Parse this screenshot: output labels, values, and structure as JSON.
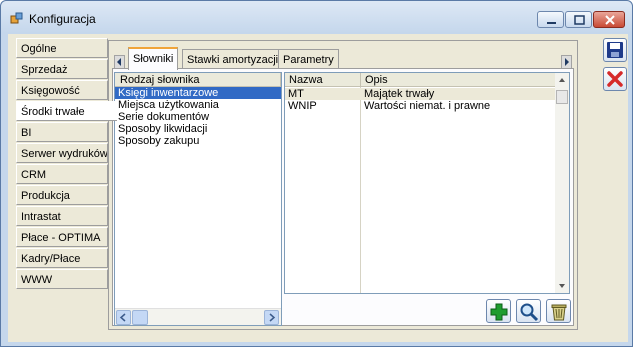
{
  "window": {
    "title": "Konfiguracja"
  },
  "nav": {
    "items": [
      {
        "label": "Ogólne"
      },
      {
        "label": "Sprzedaż"
      },
      {
        "label": "Księgowość"
      },
      {
        "label": "Środki trwałe"
      },
      {
        "label": "BI"
      },
      {
        "label": "Serwer wydruków"
      },
      {
        "label": "CRM"
      },
      {
        "label": "Produkcja"
      },
      {
        "label": "Intrastat"
      },
      {
        "label": "Płace - OPTIMA"
      },
      {
        "label": "Kadry/Płace"
      },
      {
        "label": "WWW"
      }
    ],
    "active": "Środki trwałe"
  },
  "tabs": [
    {
      "label": "Słowniki"
    },
    {
      "label": "Stawki amortyzacji"
    },
    {
      "label": "Parametry"
    }
  ],
  "dictionary_list": {
    "header": "Rodzaj słownika",
    "items": [
      {
        "label": "Księgi inwentarzowe"
      },
      {
        "label": "Miejsca użytkowania"
      },
      {
        "label": "Serie dokumentów"
      },
      {
        "label": "Sposoby likwidacji"
      },
      {
        "label": "Sposoby zakupu"
      }
    ],
    "selected": "Księgi inwentarzowe"
  },
  "grid": {
    "columns": [
      {
        "label": "Nazwa"
      },
      {
        "label": "Opis"
      }
    ],
    "rows": [
      {
        "name": "MT",
        "desc": "Majątek trwały"
      },
      {
        "name": "WNIP",
        "desc": "Wartości niemat. i prawne"
      }
    ]
  },
  "icons": {
    "app": "app-icon",
    "save": "save-icon",
    "cancel": "close-icon",
    "add": "plus-icon",
    "search": "magnifier-icon",
    "delete": "trash-icon"
  },
  "colors": {
    "selection": "#316ac5",
    "active_tab_accent": "#f0a43a",
    "save": "#1e3a8a",
    "cancel": "#d62a2a",
    "add": "#1f9d2f"
  }
}
